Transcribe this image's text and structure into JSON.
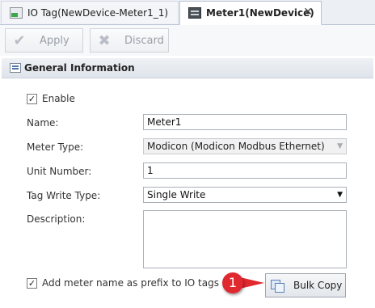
{
  "tabs": [
    {
      "label": "IO Tag(NewDevice-Meter1_1)",
      "icon": "io-tag-icon"
    },
    {
      "label": "Meter1(NewDevice)",
      "icon": "device-icon",
      "close": "✕"
    }
  ],
  "toolbar": {
    "apply_label": "Apply",
    "discard_label": "Discard",
    "apply_icon": "checkmark-icon",
    "discard_icon": "x-icon"
  },
  "panel": {
    "title": "General Information",
    "icon": "info-panel-icon"
  },
  "form": {
    "enable_label": "Enable",
    "enable_checked": true,
    "name_label": "Name:",
    "name_value": "Meter1",
    "meter_type_label": "Meter Type:",
    "meter_type_value": "Modicon (Modicon Modbus Ethernet)",
    "unit_number_label": "Unit Number:",
    "unit_number_value": "1",
    "tag_write_type_label": "Tag Write Type:",
    "tag_write_type_value": "Single Write",
    "description_label": "Description:",
    "description_value": "",
    "prefix_label": "Add meter name as prefix to IO tags",
    "prefix_checked": true
  },
  "bulk_copy": {
    "label": "Bulk Copy",
    "icon": "copy-icon"
  },
  "callout": {
    "number": "1",
    "color": "#e0282f"
  }
}
